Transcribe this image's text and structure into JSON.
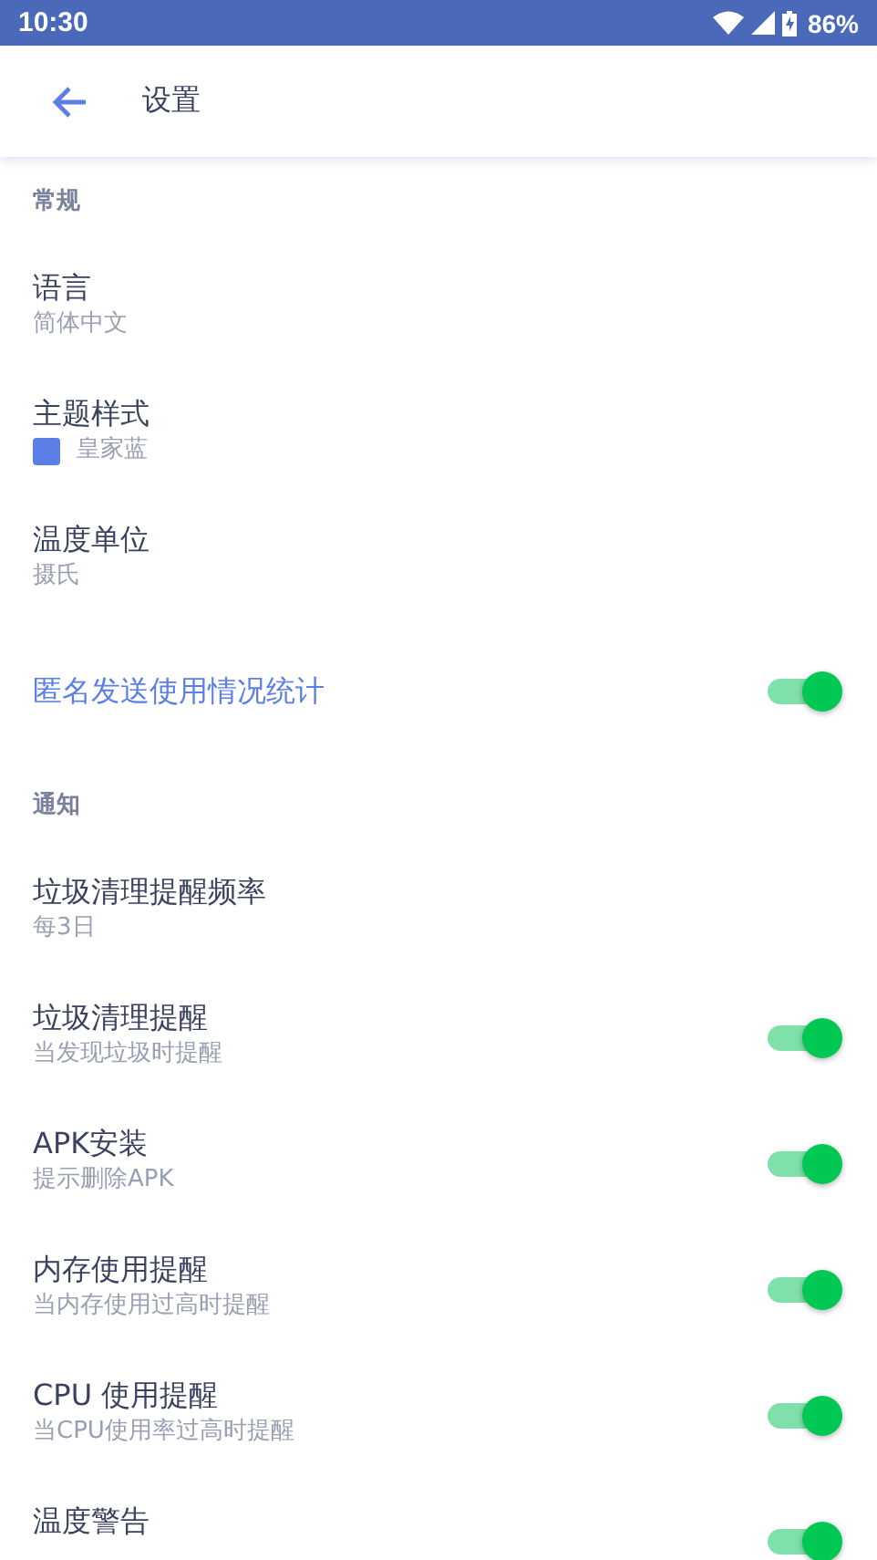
{
  "status_bar": {
    "time": "10:30",
    "battery": "86%"
  },
  "app_bar": {
    "title": "设置"
  },
  "sections": [
    {
      "header": "常规",
      "items": [
        {
          "kind": "value",
          "title": "语言",
          "subtitle": "简体中文",
          "highlighted": false
        },
        {
          "kind": "color",
          "title": "主题样式",
          "subtitle": "皇家蓝",
          "color": "#5b7fe6",
          "highlighted": false
        },
        {
          "kind": "value",
          "title": "温度单位",
          "subtitle": "摄氏",
          "highlighted": false
        },
        {
          "kind": "toggle",
          "title": "匿名发送使用情况统计",
          "on": true,
          "highlighted": true
        }
      ]
    },
    {
      "header": "通知",
      "items": [
        {
          "kind": "value",
          "title": "垃圾清理提醒频率",
          "subtitle": "每3日",
          "highlighted": false
        },
        {
          "kind": "toggle",
          "title": "垃圾清理提醒",
          "subtitle": "当发现垃圾时提醒",
          "on": true,
          "highlighted": false
        },
        {
          "kind": "toggle",
          "title": "APK安装",
          "subtitle": "提示删除APK",
          "on": true,
          "highlighted": false
        },
        {
          "kind": "toggle",
          "title": "内存使用提醒",
          "subtitle": "当内存使用过高时提醒",
          "on": true,
          "highlighted": false
        },
        {
          "kind": "toggle",
          "title": "CPU 使用提醒",
          "subtitle": "当CPU使用率过高时提醒",
          "on": true,
          "highlighted": false
        },
        {
          "kind": "toggle",
          "title": "温度警告",
          "on": true,
          "highlighted": false
        }
      ]
    }
  ]
}
